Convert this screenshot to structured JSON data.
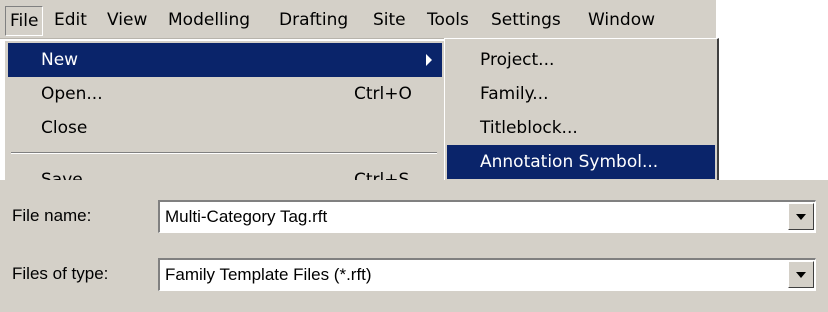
{
  "menubar": {
    "items": [
      {
        "label": "File",
        "active": true
      },
      {
        "label": "Edit"
      },
      {
        "label": "View"
      },
      {
        "label": "Modelling"
      },
      {
        "label": "Drafting"
      },
      {
        "label": "Site"
      },
      {
        "label": "Tools"
      },
      {
        "label": "Settings"
      },
      {
        "label": "Window"
      }
    ]
  },
  "file_menu": {
    "items": [
      {
        "label": "New",
        "shortcut": "",
        "highlighted": true,
        "submenu": true
      },
      {
        "label": "Open...",
        "shortcut": "Ctrl+O"
      },
      {
        "label": "Close",
        "shortcut": ""
      },
      {
        "label": "Save",
        "shortcut": "Ctrl+S"
      }
    ]
  },
  "new_submenu": {
    "items": [
      {
        "label": "Project..."
      },
      {
        "label": "Family..."
      },
      {
        "label": "Titleblock..."
      },
      {
        "label": "Annotation Symbol...",
        "highlighted": true
      }
    ]
  },
  "dialog": {
    "file_name_label": "File name:",
    "file_name_value": "Multi-Category Tag.rft",
    "file_type_label": "Files of type:",
    "file_type_value": "Family Template Files (*.rft)"
  },
  "colors": {
    "highlight": "#0a246a",
    "face": "#d4d0c8"
  },
  "icons": {
    "submenu_arrow": "triangle-right-icon",
    "dropdown": "chevron-down-icon"
  }
}
